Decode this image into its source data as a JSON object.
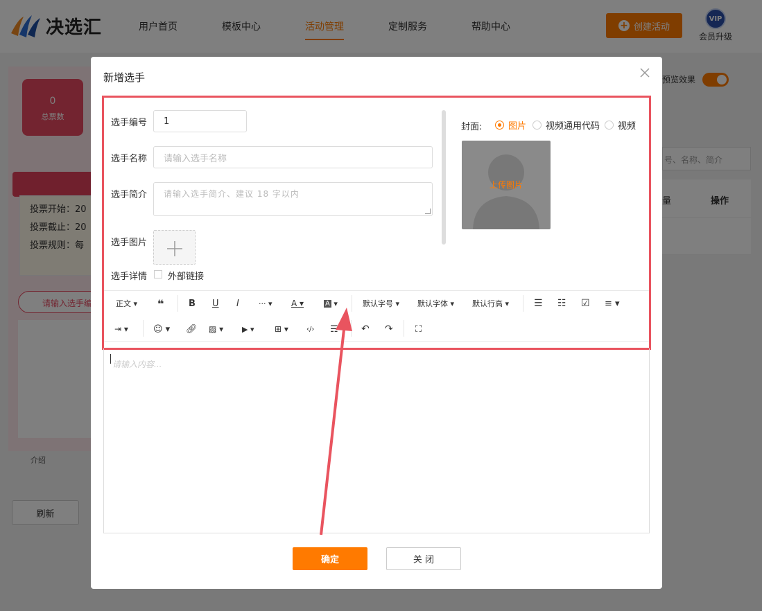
{
  "brand": {
    "name": "决选汇"
  },
  "nav": {
    "items": [
      "用户首页",
      "模板中心",
      "活动管理",
      "定制服务",
      "帮助中心"
    ],
    "active_index": 2
  },
  "header": {
    "create_label": "创建活动",
    "vip_badge": "VIP",
    "vip_label": "会员升级"
  },
  "background": {
    "total_count": "0",
    "total_label": "总票数",
    "info_rows": [
      "投票开始：20",
      "投票截止：20",
      "投票规则：每"
    ],
    "search_placeholder": "请输入选手编",
    "intro_label": "介绍",
    "refresh_label": "刷新",
    "preview_label": "预览效果",
    "right_search_placeholder": "号、名称、简介",
    "col_ops": "操作",
    "col_prev": "量"
  },
  "modal": {
    "title": "新增选手",
    "form": {
      "number_label": "选手编号",
      "number_value": "1",
      "name_label": "选手名称",
      "name_placeholder": "请输入选手名称",
      "intro_label": "选手简介",
      "intro_placeholder": "请输入选手简介、建议 18 字以内",
      "image_label": "选手图片",
      "detail_label": "选手详情",
      "external_link_label": "外部链接"
    },
    "cover": {
      "label": "封面:",
      "options": [
        "图片",
        "视频通用代码",
        "视频"
      ],
      "selected_index": 0,
      "upload_text": "上传图片"
    },
    "toolbar": {
      "paragraph": "正文",
      "more": "···",
      "font_size": "默认字号",
      "font_family": "默认字体",
      "line_height": "默认行高"
    },
    "editor_placeholder": "请输入内容...",
    "ok_label": "确定",
    "close_label": "关 闭"
  },
  "colors": {
    "accent": "#ff7a00",
    "annotation": "#e9545f"
  }
}
